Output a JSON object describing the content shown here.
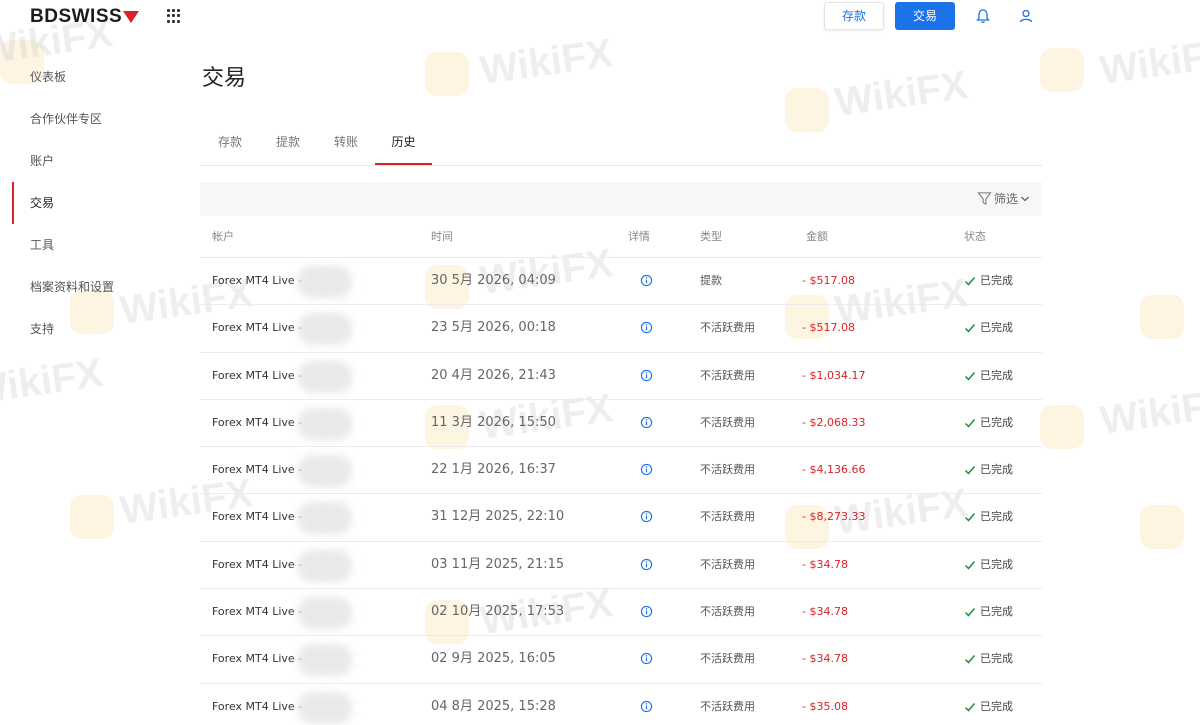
{
  "header": {
    "logo_text": "BDSWISS",
    "deposit_label": "存款",
    "trade_label": "交易"
  },
  "sidebar": {
    "items": [
      {
        "label": "仪表板"
      },
      {
        "label": "合作伙伴专区"
      },
      {
        "label": "账户"
      },
      {
        "label": "交易"
      },
      {
        "label": "工具"
      },
      {
        "label": "档案资料和设置"
      },
      {
        "label": "支持"
      }
    ]
  },
  "main": {
    "title": "交易",
    "tabs": [
      {
        "label": "存款"
      },
      {
        "label": "提款"
      },
      {
        "label": "转账"
      },
      {
        "label": "历史"
      }
    ],
    "filter_label": "筛选",
    "table": {
      "headers": {
        "account": "帐户",
        "time": "时间",
        "details": "详情",
        "type": "类型",
        "amount": "金额",
        "status": "状态"
      },
      "rows": [
        {
          "account": "Forex MT4 Live - ",
          "time": "30 5月 2026, 04:09",
          "type": "提款",
          "amount": "- $517.08",
          "status": "已完成"
        },
        {
          "account": "Forex MT4 Live - 5",
          "time": "23 5月 2026, 00:18",
          "type": "不活跃费用",
          "amount": "- $517.08",
          "status": "已完成"
        },
        {
          "account": "Forex MT4 Live - 5",
          "time": "20 4月 2026, 21:43",
          "type": "不活跃费用",
          "amount": "- $1,034.17",
          "status": "已完成"
        },
        {
          "account": "Forex MT4 Live - ",
          "time": "11 3月 2026, 15:50",
          "type": "不活跃费用",
          "amount": "- $2,068.33",
          "status": "已完成"
        },
        {
          "account": "Forex MT4 Live - 5",
          "time": "22 1月 2026, 16:37",
          "type": "不活跃费用",
          "amount": "- $4,136.66",
          "status": "已完成"
        },
        {
          "account": "Forex MT4 Live - ",
          "time": "31 12月 2025, 22:10",
          "type": "不活跃费用",
          "amount": "- $8,273.33",
          "status": "已完成"
        },
        {
          "account": "Forex MT4 Live - ",
          "time": "03 11月 2025, 21:15",
          "type": "不活跃费用",
          "amount": "- $34.78",
          "status": "已完成"
        },
        {
          "account": "Forex MT4 Live - ",
          "time": "02 10月 2025, 17:53",
          "type": "不活跃费用",
          "amount": "- $34.78",
          "status": "已完成"
        },
        {
          "account": "Forex MT4 Live - 5",
          "time": "02 9月 2025, 16:05",
          "type": "不活跃费用",
          "amount": "- $34.78",
          "status": "已完成"
        },
        {
          "account": "Forex MT4 Live - ",
          "time": "04 8月 2025, 15:28",
          "type": "不活跃费用",
          "amount": "- $35.08",
          "status": "已完成"
        }
      ]
    }
  },
  "watermark_text": "WikiFX",
  "colors": {
    "accent_red": "#d8232a",
    "primary_blue": "#1a73e8",
    "success_green": "#1e8e3e"
  },
  "icons": [
    "apps-grid-icon",
    "bell-icon",
    "user-icon",
    "filter-icon",
    "chevron-down-icon",
    "info-icon",
    "check-icon"
  ]
}
